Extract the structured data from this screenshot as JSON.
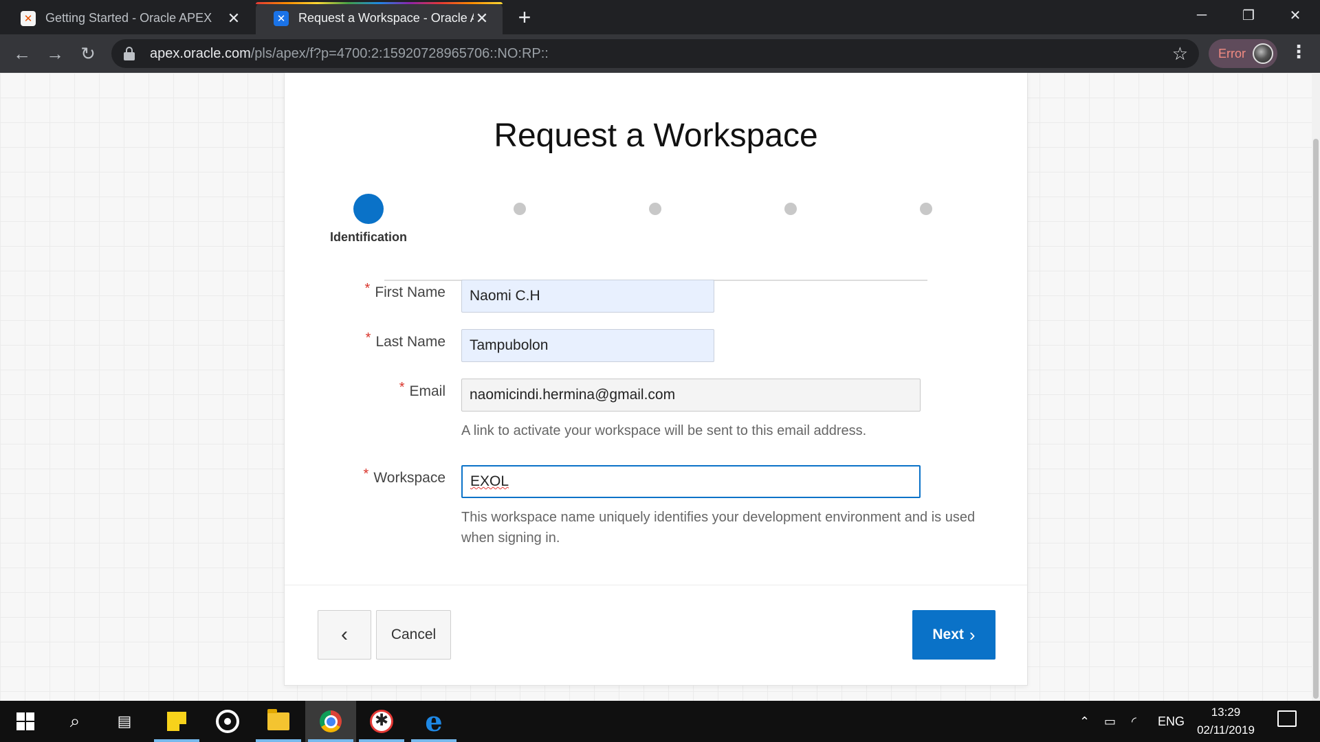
{
  "browser": {
    "tabs": [
      {
        "title": "Getting Started - Oracle APEX",
        "favicon": "apex-icon",
        "active": false
      },
      {
        "title": "Request a Workspace - Oracle Ap",
        "favicon": "apex-icon",
        "active": true
      }
    ],
    "close_glyph": "✕",
    "new_tab_glyph": "+",
    "window": {
      "minimize": "─",
      "restore": "❐",
      "close": "✕"
    },
    "url_host": "apex.oracle.com",
    "url_path": "/pls/apex/f?p=4700:2:15920728965706::NO:RP::",
    "profile_status": "Error",
    "nav": {
      "back": "←",
      "forward": "→",
      "reload": "↻",
      "star": "☆",
      "menu": "⋮"
    }
  },
  "page": {
    "title": "Request a Workspace",
    "wizard": {
      "steps_count": 5,
      "active_index": 0,
      "active_label": "Identification"
    },
    "form": {
      "required_mark": "*",
      "first_name": {
        "label": "First Name",
        "value": "Naomi C.H"
      },
      "last_name": {
        "label": "Last Name",
        "value": "Tampubolon"
      },
      "email": {
        "label": "Email",
        "value": "naomicindi.hermina@gmail.com",
        "help": "A link to activate your workspace will be sent to this email address."
      },
      "workspace": {
        "label": "Workspace",
        "value": "EXOL",
        "help": "This workspace name uniquely identifies your development environment and is used when signing in."
      }
    },
    "buttons": {
      "back_glyph": "‹",
      "cancel": "Cancel",
      "next": "Next",
      "next_glyph": "›"
    }
  },
  "taskbar": {
    "apps": [
      "windows-start",
      "search",
      "task-view",
      "sticky-notes",
      "groove-music",
      "file-explorer",
      "chrome",
      "webcam-app",
      "edge"
    ],
    "tray": {
      "language": "ENG",
      "time": "13:29",
      "date": "02/11/2019"
    }
  },
  "colors": {
    "accent": "#0a72c8",
    "required": "#d9342b",
    "autofill": "#e8f0fe",
    "browser_dark": "#202124"
  }
}
